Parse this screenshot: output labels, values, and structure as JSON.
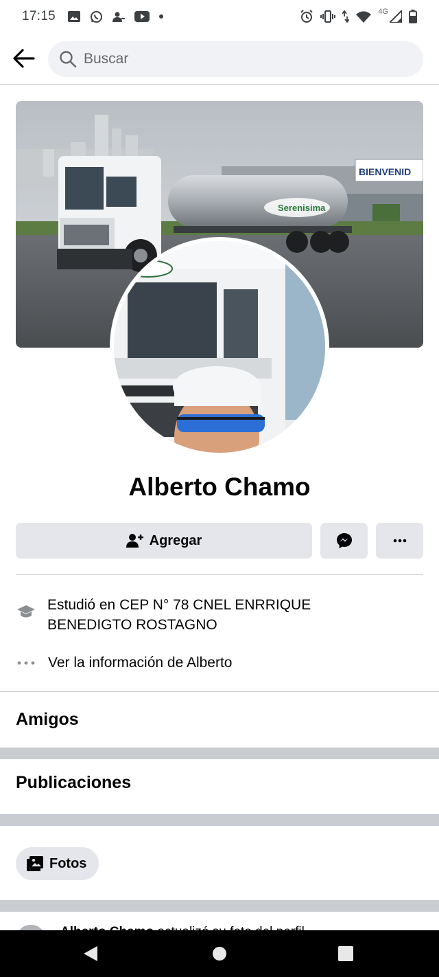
{
  "status_bar": {
    "time": "17:15",
    "network": "4G",
    "left_icons": [
      "gallery-icon",
      "whatsapp-icon",
      "contact-icon",
      "youtube-icon",
      "dot-icon"
    ],
    "right_icons": [
      "alarm-icon",
      "vibrate-icon",
      "data-arrows-icon",
      "wifi-icon",
      "signal-icon",
      "battery-icon"
    ]
  },
  "search": {
    "placeholder": "Buscar"
  },
  "profile": {
    "cover_sign": "BIENVENID",
    "tanker_brand": "Serenisima",
    "name": "Alberto Chamo"
  },
  "actions": {
    "add_label": "Agregar",
    "add_icon": "add-friend-icon",
    "message_icon": "messenger-icon",
    "more_icon": "more-icon"
  },
  "about": {
    "education": "Estudió en CEP N° 78 CNEL ENRRIQUE BENEDIGTO ROSTAGNO",
    "see_info": "Ver la información de Alberto"
  },
  "sections": {
    "friends": "Amigos",
    "posts": "Publicaciones"
  },
  "filters": {
    "photos": "Fotos"
  },
  "post_preview": {
    "author": "Alberto Chamo",
    "action": "actualizó su foto del perfil."
  },
  "colors": {
    "background": "#ffffff",
    "button_gray": "#e4e6eb",
    "search_gray": "#f0f2f5",
    "divider": "#c9ccd1",
    "text": "#050505",
    "secondary_text": "#65676b"
  }
}
